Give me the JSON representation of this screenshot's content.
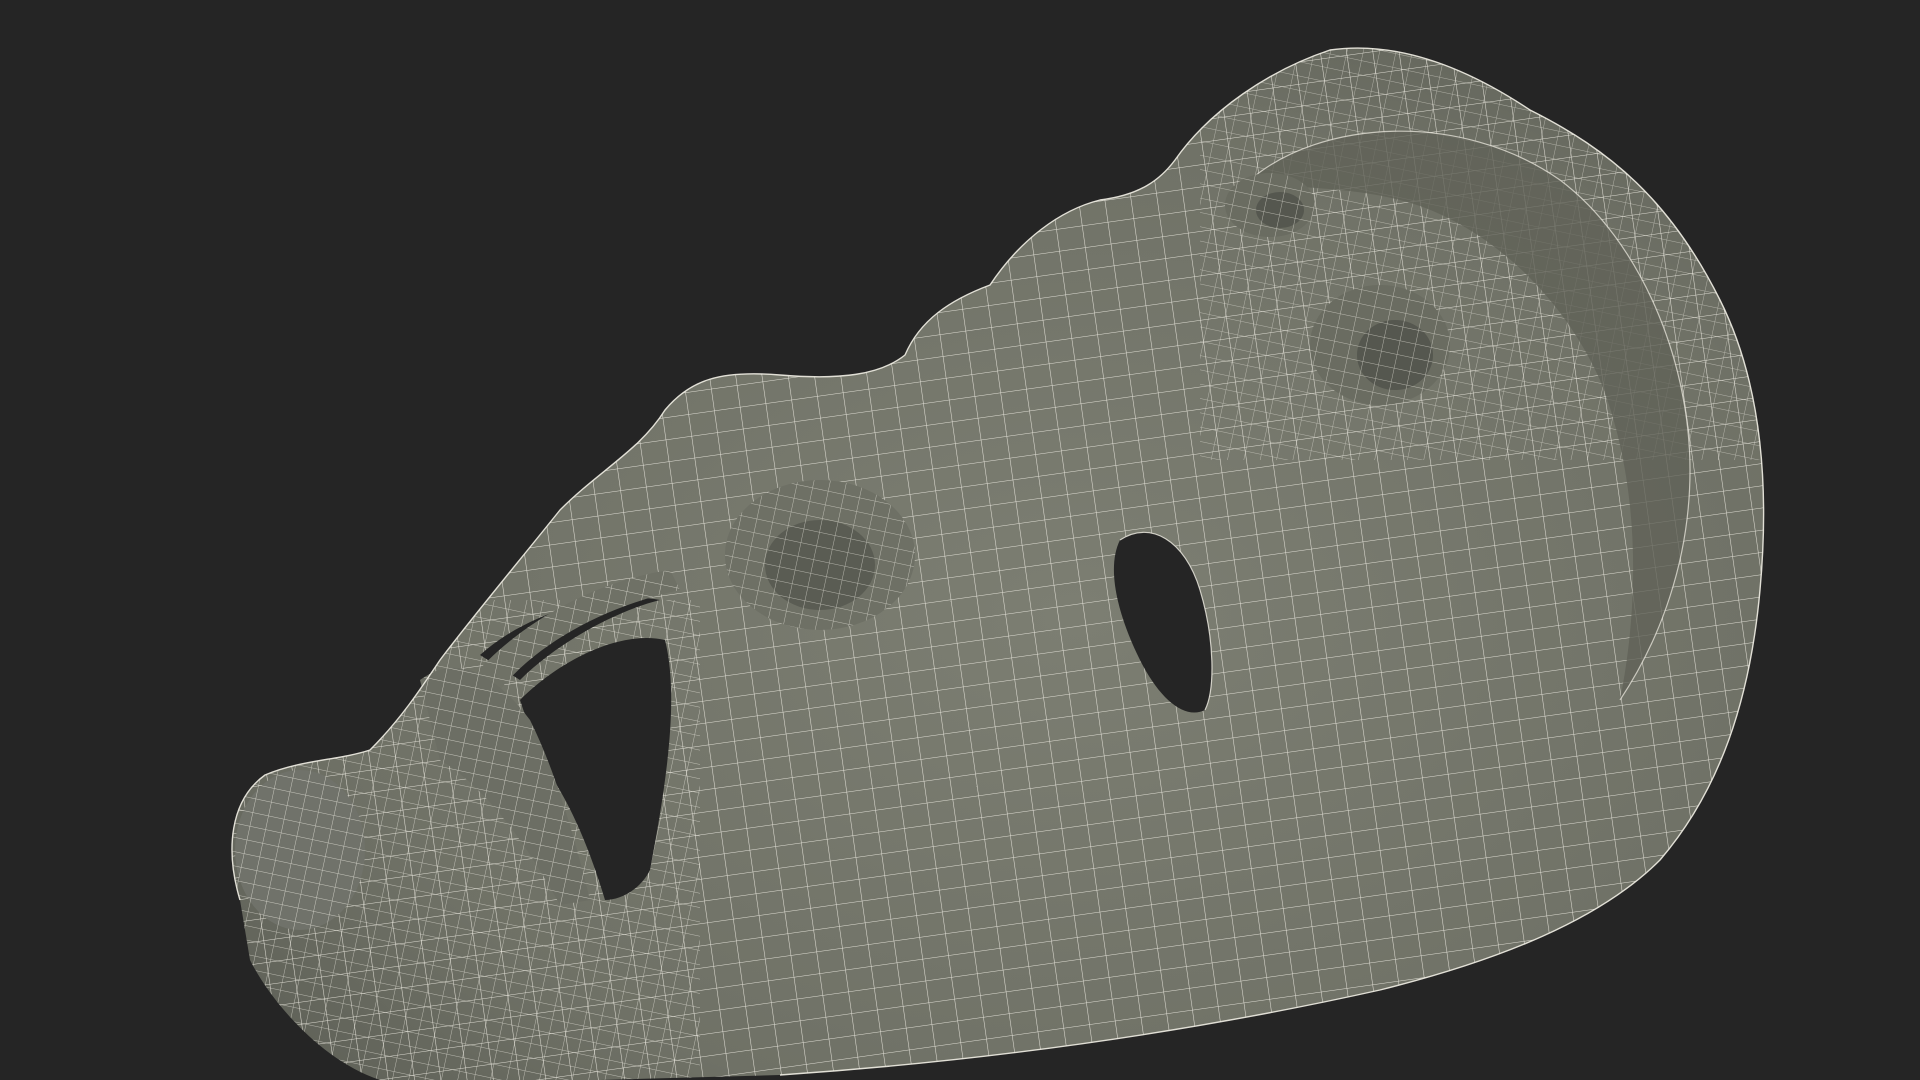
{
  "scene": {
    "subject": "wireframe-3d-mesh",
    "colors": {
      "background": "#252525",
      "surface": "#74766b",
      "surface_light": "#8a8c80",
      "surface_dark": "#55574f",
      "wire": "#f2f0e6",
      "hole": "#252525"
    }
  }
}
